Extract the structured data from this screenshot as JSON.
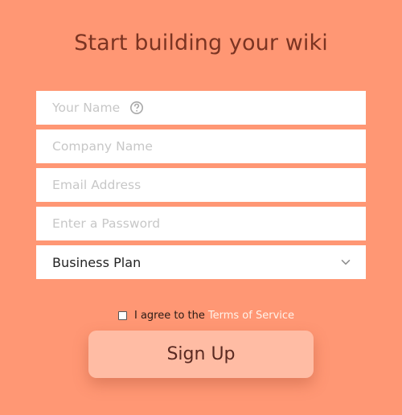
{
  "header": {
    "title": "Start building your wiki"
  },
  "form": {
    "name_placeholder": "Your Name",
    "company_placeholder": "Company Name",
    "email_placeholder": "Email Address",
    "password_placeholder": "Enter a Password",
    "plan_value": "Business Plan",
    "help_icon": "question-circle-icon",
    "dropdown_icon": "chevron-down-icon"
  },
  "agreement": {
    "prefix": "I agree to the",
    "link": "Terms of Service",
    "checked": false
  },
  "actions": {
    "signup_label": "Sign Up"
  },
  "colors": {
    "background": "#ff9774",
    "title": "#7b3422",
    "field_background": "#ffffff",
    "button_background": "#ffbca4",
    "link": "#fff3ea"
  }
}
